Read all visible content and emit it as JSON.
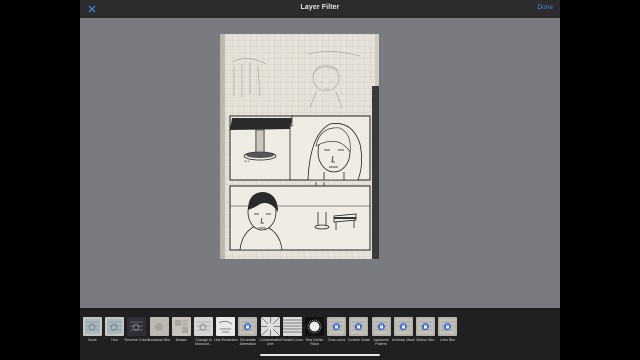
{
  "header": {
    "title": "Layer Filter",
    "done_label": "Done"
  },
  "filters": [
    {
      "label": "None",
      "icon": "plain-photo-icon",
      "locked": false
    },
    {
      "label": "Hue",
      "icon": "plain-photo-icon",
      "locked": false
    },
    {
      "label": "Reverse Colors",
      "icon": "inverted-photo-icon",
      "locked": false
    },
    {
      "label": "Gaussian Blur",
      "icon": "blur-photo-icon",
      "locked": false
    },
    {
      "label": "Mosaic",
      "icon": "mosaic-photo-icon",
      "locked": false
    },
    {
      "label": "Change to Monochr...",
      "icon": "mono-photo-icon",
      "locked": false
    },
    {
      "label": "Line Extraction",
      "icon": "line-photo-icon",
      "locked": false
    },
    {
      "label": "Chromatic Aberration",
      "icon": "lock-icon",
      "locked": true
    },
    {
      "label": "Concentrated Line",
      "icon": "burst-lines-icon",
      "locked": false
    },
    {
      "label": "Parallel Lines",
      "icon": "parallel-lines-icon",
      "locked": false
    },
    {
      "label": "Sea Urchin Flash",
      "icon": "urchin-flash-icon",
      "locked": false
    },
    {
      "label": "Tone curve",
      "icon": "lock-icon",
      "locked": true
    },
    {
      "label": "Custom Noise",
      "icon": "lock-icon",
      "locked": true
    },
    {
      "label": "Japanese Pattern",
      "icon": "lock-icon",
      "locked": true
    },
    {
      "label": "Unsharp Mask",
      "icon": "lock-icon",
      "locked": true
    },
    {
      "label": "Motion Blur",
      "icon": "lock-icon",
      "locked": true
    },
    {
      "label": "Lens Blur",
      "icon": "lock-icon",
      "locked": true
    }
  ]
}
